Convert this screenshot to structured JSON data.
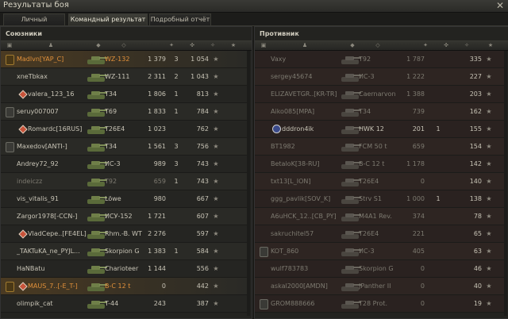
{
  "window": {
    "title": "Результаты боя",
    "close_icon": "close-icon"
  },
  "tabs": [
    {
      "label": "Личный результат"
    },
    {
      "label": "Командный результат"
    },
    {
      "label": "Подробный отчёт"
    }
  ],
  "allies": {
    "title": "Союзники",
    "rows": [
      {
        "platoon": "gold",
        "platoon_label": "",
        "name": "Madlvn[YAP_C]",
        "tank": "WZ-132",
        "dmg": "1 379",
        "kills": "3",
        "xp": "1 054",
        "name_style": "orange",
        "tank_style": "orange",
        "highlight": true
      },
      {
        "platoon": "",
        "name": "xneTbkax",
        "tank": "WZ-111",
        "dmg": "2 311",
        "kills": "2",
        "xp": "1 043"
      },
      {
        "platoon": "",
        "diamond": true,
        "name": "valera_123_16",
        "tank": "T34",
        "dmg": "1 806",
        "kills": "1",
        "xp": "813"
      },
      {
        "platoon": "grey",
        "platoon_label": "",
        "name": "seruy007007",
        "tank": "T69",
        "dmg": "1 833",
        "kills": "1",
        "xp": "784"
      },
      {
        "platoon": "",
        "diamond": true,
        "name": "Romardc[16RUS]",
        "tank": "T26E4",
        "dmg": "1 023",
        "kills": "",
        "xp": "762"
      },
      {
        "platoon": "grey",
        "platoon_label": "",
        "name": "Maxedov[ANTI-]",
        "tank": "T34",
        "dmg": "1 561",
        "kills": "3",
        "xp": "756"
      },
      {
        "platoon": "",
        "name": "Andrey72_92",
        "tank": "ИС-3",
        "dmg": "989",
        "kills": "3",
        "xp": "743"
      },
      {
        "platoon": "",
        "name": "indeiczz",
        "tank": "T92",
        "dmg": "659",
        "kills": "1",
        "xp": "743",
        "name_style": "dim",
        "tank_style": "dim",
        "num_style": "dim"
      },
      {
        "platoon": "",
        "name": "vis_vitalis_91",
        "tank": "Löwe",
        "dmg": "980",
        "kills": "",
        "xp": "667"
      },
      {
        "platoon": "",
        "name": "Zargor1978[-CCN-]",
        "tank": "ИСУ-152",
        "dmg": "1 721",
        "kills": "",
        "xp": "607"
      },
      {
        "platoon": "",
        "diamond": true,
        "name": "VladCepe..[FE4EL]",
        "tank": "Rhm.-B. WT",
        "dmg": "2 276",
        "kills": "",
        "xp": "597"
      },
      {
        "platoon": "",
        "name": "_TAKTuKA_ne_PYJL...",
        "tank": "Skorpion G",
        "dmg": "1 383",
        "kills": "1",
        "xp": "584"
      },
      {
        "platoon": "",
        "name": "HaNBatu",
        "tank": "Charioteer",
        "dmg": "1 144",
        "kills": "",
        "xp": "556"
      },
      {
        "platoon": "gold",
        "platoon_label": "",
        "diamond": true,
        "name": "MAUS_7..[-E_T-]",
        "tank": "B-C 12 t",
        "dmg": "0",
        "kills": "",
        "xp": "442",
        "name_style": "orange",
        "tank_style": "orange",
        "highlight": true
      },
      {
        "platoon": "",
        "name": "olimpik_cat",
        "tank": "T-44",
        "dmg": "243",
        "kills": "",
        "xp": "387"
      }
    ]
  },
  "enemies": {
    "title": "Противник",
    "rows": [
      {
        "platoon": "",
        "name": "Vaxy",
        "tank": "T92",
        "dmg": "1 787",
        "kills": "",
        "xp": "335",
        "dead": true
      },
      {
        "platoon": "",
        "name": "sergey45674",
        "tank": "ИС-3",
        "dmg": "1 222",
        "kills": "",
        "xp": "227",
        "dead": true
      },
      {
        "platoon": "",
        "name": "ELIZAVETGR..[KR-TR]",
        "tank": "Caernarvon",
        "dmg": "1 388",
        "kills": "",
        "xp": "203",
        "dead": true
      },
      {
        "platoon": "",
        "name": "Aiko085[MPA]",
        "tank": "T34",
        "dmg": "739",
        "kills": "",
        "xp": "162",
        "dead": true
      },
      {
        "platoon": "",
        "name": "dddron4ik",
        "tank": "HWK 12",
        "dmg": "201",
        "kills": "1",
        "xp": "155",
        "alive": true
      },
      {
        "platoon": "",
        "name": "BT1982",
        "tank": "FCM 50 t",
        "dmg": "659",
        "kills": "",
        "xp": "154",
        "dead": true
      },
      {
        "platoon": "",
        "name": "BetaloK[38-RU]",
        "tank": "B-C 12 t",
        "dmg": "1 178",
        "kills": "",
        "xp": "142",
        "dead": true
      },
      {
        "platoon": "",
        "name": "txt13[L_ION]",
        "tank": "T26E4",
        "dmg": "0",
        "kills": "",
        "xp": "140",
        "dead": true
      },
      {
        "platoon": "",
        "name": "ggg_pavlik[SOV_K]",
        "tank": "Strv S1",
        "dmg": "1 000",
        "kills": "1",
        "xp": "138",
        "dead": true
      },
      {
        "platoon": "",
        "name": "A6uHCK_12..[CB_PY]",
        "tank": "M4A1 Rev.",
        "dmg": "374",
        "kills": "",
        "xp": "78",
        "dead": true
      },
      {
        "platoon": "",
        "name": "sakruchitel57",
        "tank": "T26E4",
        "dmg": "221",
        "kills": "",
        "xp": "65",
        "dead": true
      },
      {
        "platoon": "grey",
        "platoon_label": "",
        "name": "KOT_860",
        "tank": "ИС-3",
        "dmg": "405",
        "kills": "",
        "xp": "63",
        "dead": true
      },
      {
        "platoon": "",
        "name": "wulf783783",
        "tank": "Skorpion G",
        "dmg": "0",
        "kills": "",
        "xp": "46",
        "dead": true
      },
      {
        "platoon": "",
        "name": "askal2000[AMDN]",
        "tank": "JPanther II",
        "dmg": "0",
        "kills": "",
        "xp": "40",
        "dead": true
      },
      {
        "platoon": "grey",
        "platoon_label": "",
        "name": "GROM888666",
        "tank": "T28 Prot.",
        "dmg": "0",
        "kills": "",
        "xp": "19",
        "dead": true
      }
    ]
  },
  "colors": {
    "accent": "#e0903a",
    "text": "#c8c4b6",
    "dim": "#7d7a70"
  }
}
